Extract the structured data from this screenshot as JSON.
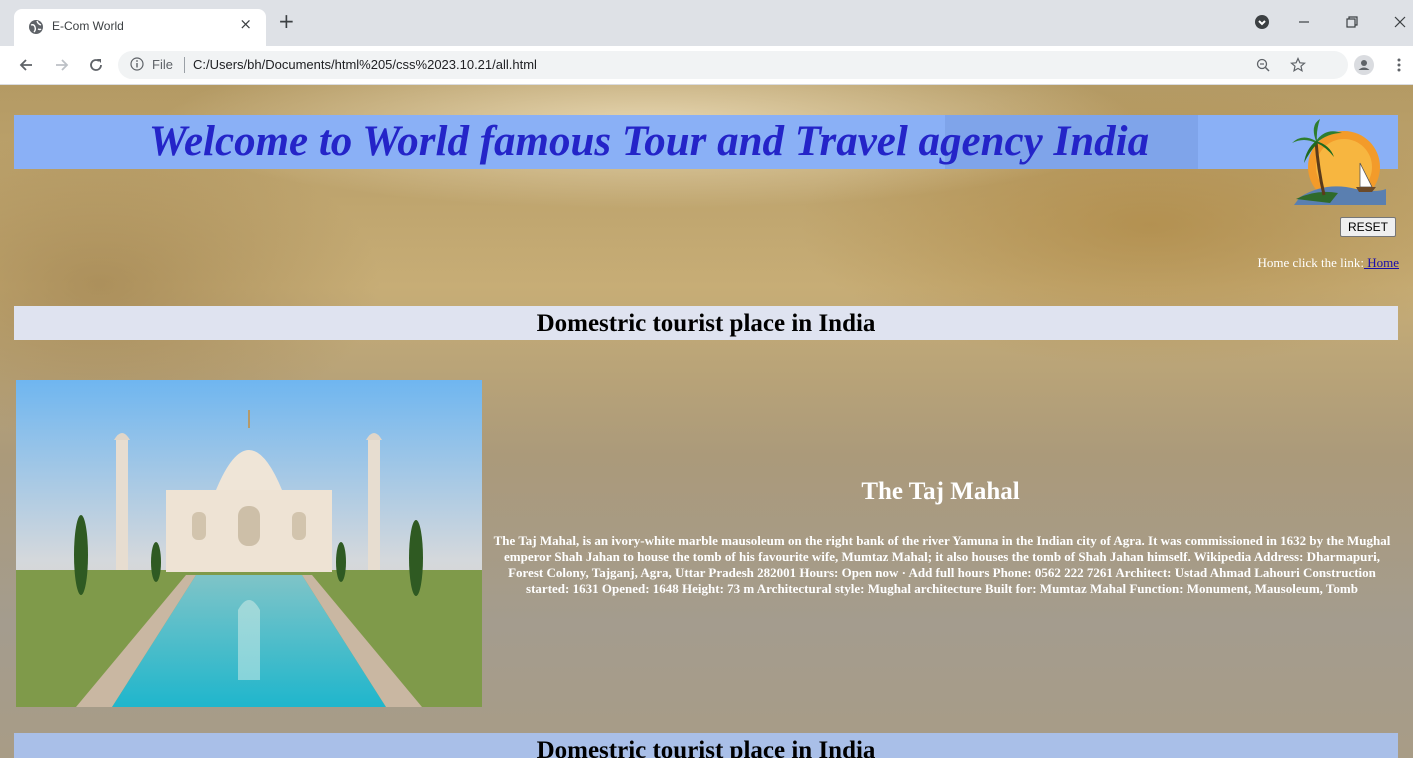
{
  "browser": {
    "tab_title": "E-Com World",
    "tab_close": "×",
    "new_tab": "+",
    "file_label": "File",
    "url": "C:/Users/bh/Documents/html%205/css%2023.10.21/all.html"
  },
  "page": {
    "banner_title": "Welcome to World famous Tour and Travel agency India",
    "reset_label": "RESET",
    "home_text": "Home click the link:",
    "home_link": " Home",
    "section_title": "Domestric tourist place in India",
    "section_title_2": "Domestric tourist place in India",
    "place": {
      "title": "The Taj Mahal",
      "description": "The Taj Mahal, is an ivory-white marble mausoleum on the right bank of the river Yamuna in the Indian city of Agra. It was commissioned in 1632 by the Mughal emperor Shah Jahan to house the tomb of his favourite wife, Mumtaz Mahal; it also houses the tomb of Shah Jahan himself. Wikipedia Address: Dharmapuri, Forest Colony, Tajganj, Agra, Uttar Pradesh 282001 Hours: Open now · Add full hours Phone: 0562 222 7261 Architect: Ustad Ahmad Lahouri Construction started: 1631 Opened: 1648 Height: 73 m Architectural style: Mughal architecture Built for: Mumtaz Mahal Function: Monument, Mausoleum, Tomb"
    }
  },
  "colors": {
    "banner_bg": "#8ab0f6",
    "banner_text": "#2424c8",
    "section_bg": "#dfe3f0"
  }
}
